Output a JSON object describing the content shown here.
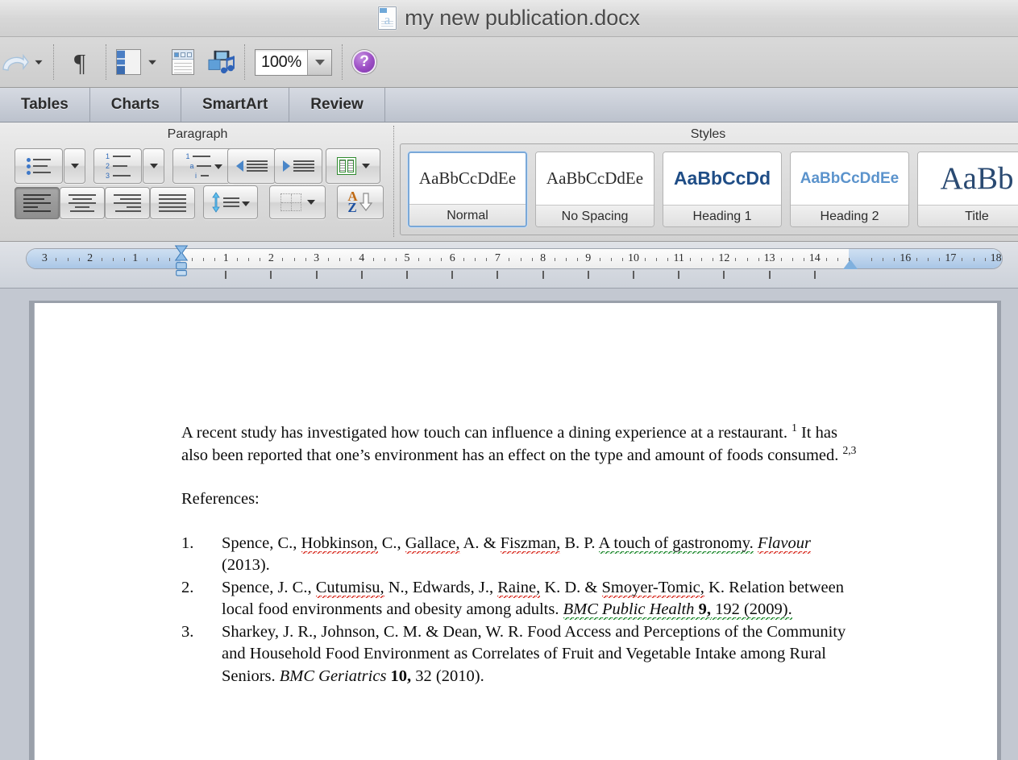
{
  "window": {
    "title": "my new publication.docx",
    "doc_icon": "word-document-icon"
  },
  "toolbar": {
    "items": [
      {
        "name": "redo",
        "icon": "redo-arrow-icon",
        "label": ""
      },
      {
        "name": "show-formatting-marks",
        "icon": "pilcrow-icon",
        "label": "¶"
      },
      {
        "name": "sidebar-pane",
        "icon": "navigation-pane-icon",
        "label": ""
      },
      {
        "name": "notebook-layout",
        "icon": "notebook-icon",
        "label": ""
      },
      {
        "name": "media-browser",
        "icon": "media-browser-icon",
        "label": ""
      }
    ],
    "zoom": {
      "value": "100%",
      "label": "Zoom level"
    },
    "help": {
      "glyph": "?",
      "label": "Help"
    }
  },
  "tabs": [
    {
      "label": "Tables",
      "active": false
    },
    {
      "label": "Charts",
      "active": false
    },
    {
      "label": "SmartArt",
      "active": false
    },
    {
      "label": "Review",
      "active": false
    }
  ],
  "ribbon": {
    "groups": [
      {
        "title": "Paragraph"
      },
      {
        "title": "Styles"
      }
    ],
    "paragraph": {
      "row1": [
        {
          "name": "bulleted-list-button",
          "icon": "bulleted-list-icon"
        },
        {
          "name": "bulleted-list-dropdown",
          "icon": "chevron-down-icon"
        },
        {
          "name": "numbered-list-button",
          "icon": "numbered-list-icon"
        },
        {
          "name": "numbered-list-dropdown",
          "icon": "chevron-down-icon"
        },
        {
          "name": "multilevel-list-button",
          "icon": "multilevel-list-icon"
        },
        {
          "name": "decrease-indent-button",
          "icon": "decrease-indent-icon"
        },
        {
          "name": "increase-indent-button",
          "icon": "increase-indent-icon"
        },
        {
          "name": "columns-button",
          "icon": "columns-icon"
        },
        {
          "name": "columns-dropdown",
          "icon": "chevron-down-icon"
        }
      ],
      "row2": [
        {
          "name": "align-left-button",
          "icon": "align-left-icon",
          "pressed": true
        },
        {
          "name": "align-center-button",
          "icon": "align-center-icon",
          "pressed": false
        },
        {
          "name": "align-right-button",
          "icon": "align-right-icon",
          "pressed": false
        },
        {
          "name": "justify-button",
          "icon": "justify-icon",
          "pressed": false
        },
        {
          "name": "line-spacing-button",
          "icon": "line-spacing-icon"
        },
        {
          "name": "shading-button",
          "icon": "shading-icon"
        },
        {
          "name": "sort-button",
          "icon": "sort-az-icon"
        }
      ]
    },
    "styles": [
      {
        "preview": "AaBbCcDdEe",
        "label": "Normal",
        "selected": true
      },
      {
        "preview": "AaBbCcDdEe",
        "label": "No Spacing",
        "selected": false
      },
      {
        "preview": "AaBbCcDd",
        "label": "Heading 1",
        "selected": false
      },
      {
        "preview": "AaBbCcDdEe",
        "label": "Heading 2",
        "selected": false
      },
      {
        "preview": "AaBb",
        "label": "Title",
        "selected": false
      }
    ]
  },
  "ruler": {
    "left_numbers": [
      "3",
      "2",
      "1"
    ],
    "right_numbers": [
      "1",
      "2",
      "3",
      "4",
      "5",
      "6",
      "7",
      "8",
      "9",
      "10",
      "11",
      "12",
      "13",
      "14",
      "16",
      "17",
      "18"
    ],
    "first_line_indent_position": "0",
    "right_indent_position": "15"
  },
  "document": {
    "paragraph1_parts": [
      {
        "t": "A recent study has investigated how touch can influence a dining experience at a restaurant. ",
        "s": "normal"
      },
      {
        "t": "1",
        "s": "sup"
      },
      {
        "t": " It has also been reported that one’s environment has an effect on the type and amount of foods consumed. ",
        "s": "normal"
      },
      {
        "t": "2,3",
        "s": "sup"
      }
    ],
    "references_heading": "References:",
    "references": [
      {
        "number": "1.",
        "text": "Spence, C., Hobkinson, C., Gallace, A. & Fiszman, B. P. A touch of gastronomy. Flavour (2013)."
      },
      {
        "number": "2.",
        "text": "Spence, J. C., Cutumisu, N., Edwards, J., Raine, K. D. & Smoyer-Tomic, K. Relation between local food environments and obesity among adults. BMC Public Health 9, 192 (2009)."
      },
      {
        "number": "3.",
        "text": "Sharkey, J. R., Johnson, C. M. & Dean, W. R. Food Access and Perceptions of the Community and Household Food Environment as Correlates of Fruit and Vegetable Intake among Rural Seniors. BMC Geriatrics 10, 32 (2010)."
      }
    ]
  },
  "colors": {
    "titlebar": "#d7d7d7",
    "tabbar": "#bcc2cd",
    "ribbon": "#dcdcdc",
    "canvas": "#c3c8d1",
    "page": "#ffffff",
    "selection_blue": "#7aa8d8",
    "spelling_red": "#d93025",
    "grammar_green": "#1e8a2e",
    "heading_blue": "#1f4d86"
  }
}
